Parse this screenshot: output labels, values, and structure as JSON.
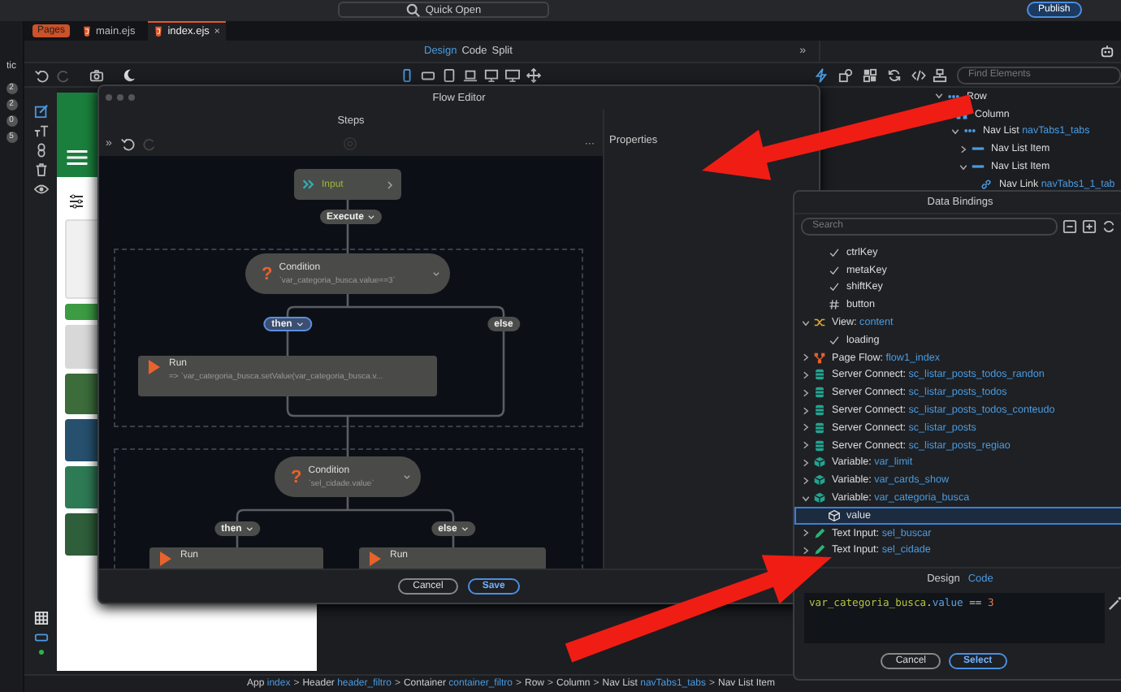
{
  "top_bar": {
    "quick_open": "Quick Open",
    "publish": "Publish"
  },
  "left_strip": {
    "label": "tic",
    "badges": [
      "2",
      "2",
      "0",
      "5"
    ]
  },
  "file_tabs": [
    {
      "label": "Pages",
      "kind": "badge",
      "selected": false
    },
    {
      "label": "main.ejs",
      "kind": "file",
      "selected": false
    },
    {
      "label": "index.ejs",
      "kind": "file",
      "selected": true,
      "close": "×"
    }
  ],
  "view_modes": [
    {
      "label": "Design",
      "selected": true
    },
    {
      "label": "Code",
      "selected": false
    },
    {
      "label": "Split",
      "selected": false
    }
  ],
  "panel_toggle": "»",
  "find_elements": {
    "placeholder": "Find Elements"
  },
  "tree": [
    {
      "kind": "row",
      "label": "Row",
      "expanded": true,
      "children": [
        {
          "kind": "column",
          "label": "Column",
          "children": [
            {
              "kind": "navlist",
              "label": "Nav List",
              "id": "navTabs1_tabs",
              "expanded": true,
              "children": [
                {
                  "kind": "item",
                  "label": "Nav List Item",
                  "expanded": false
                },
                {
                  "kind": "item",
                  "label": "Nav List Item",
                  "expanded": true,
                  "children": [
                    {
                      "kind": "link",
                      "label": "Nav Link",
                      "id": "navTabs1_1_tab"
                    }
                  ]
                }
              ]
            }
          ]
        }
      ]
    }
  ],
  "flow_editor": {
    "title": "Flow Editor",
    "steps": "Steps",
    "toggle": "»",
    "more": "···",
    "properties": "Properties",
    "input": "Input",
    "execute": "Execute",
    "blocks": [
      {
        "icon": "?",
        "condition": "Condition",
        "expression": "`var_categoria_busca.value==3`",
        "branches": [
          {
            "label": "then",
            "selected": true,
            "caret": true,
            "runs": [
              {
                "title": "Run",
                "expression": "=>  `var_categoria_busca.setValue(var_categoria_busca.v..."
              }
            ]
          },
          {
            "label": "else",
            "selected": false,
            "caret": false
          }
        ]
      },
      {
        "icon": "?",
        "condition": "Condition",
        "expression": "`sel_cidade.value`",
        "branches": [
          {
            "label": "then",
            "selected": false,
            "caret": true,
            "runs": [
              {
                "title": "Run"
              }
            ]
          },
          {
            "label": "else",
            "selected": false,
            "caret": true,
            "runs": [
              {
                "title": "Run"
              }
            ]
          }
        ]
      }
    ],
    "buttons": [
      {
        "label": "Cancel",
        "kind": "secondary"
      },
      {
        "label": "Save",
        "kind": "primary"
      }
    ]
  },
  "data_bindings": {
    "title": "Data Bindings",
    "search": {
      "placeholder": "Search"
    },
    "items": [
      {
        "children": [
          {
            "kind": "check",
            "name": "ctrlKey",
            "selected": false
          },
          {
            "kind": "check",
            "name": "metaKey",
            "selected": false
          },
          {
            "kind": "check",
            "name": "shiftKey",
            "selected": false
          },
          {
            "kind": "hash",
            "name": "button",
            "selected": false
          }
        ]
      },
      {
        "kind": "view",
        "name": "View:",
        "value": "content",
        "expanded": true,
        "selected": false,
        "children": [
          {
            "kind": "check",
            "name": "loading",
            "selected": false
          }
        ]
      },
      {
        "kind": "flow",
        "name": "Page Flow:",
        "value": "flow1_index",
        "expanded": false,
        "selected": false
      },
      {
        "kind": "server",
        "name": "Server Connect:",
        "value": "sc_listar_posts_todos_randon",
        "expanded": false,
        "selected": false
      },
      {
        "kind": "server",
        "name": "Server Connect:",
        "value": "sc_listar_posts_todos",
        "expanded": false,
        "selected": false
      },
      {
        "kind": "server",
        "name": "Server Connect:",
        "value": "sc_listar_posts_todos_conteudo",
        "expanded": false,
        "selected": false
      },
      {
        "kind": "server",
        "name": "Server Connect:",
        "value": "sc_listar_posts",
        "expanded": false,
        "selected": false
      },
      {
        "kind": "server",
        "name": "Server Connect:",
        "value": "sc_listar_posts_regiao",
        "expanded": false,
        "selected": false
      },
      {
        "kind": "variable",
        "name": "Variable:",
        "value": "var_limit",
        "expanded": false,
        "selected": false
      },
      {
        "kind": "variable",
        "name": "Variable:",
        "value": "var_cards_show",
        "expanded": false,
        "selected": false
      },
      {
        "kind": "variable",
        "name": "Variable:",
        "value": "var_categoria_busca",
        "expanded": true,
        "selected": false,
        "children": [
          {
            "kind": "value",
            "name": "value",
            "selected": true
          }
        ]
      },
      {
        "kind": "text_input",
        "name": "Text Input:",
        "value": "sel_buscar",
        "expanded": false,
        "selected": false
      },
      {
        "kind": "text_input",
        "name": "Text Input:",
        "value": "sel_cidade",
        "expanded": false,
        "selected": false
      }
    ],
    "tabs": [
      {
        "label": "Design",
        "selected": false
      },
      {
        "label": "Code",
        "selected": true
      }
    ],
    "code": [
      {
        "kind": "identifier",
        "text": "var_categoria_busca"
      },
      {
        "kind": "punct",
        "text": "."
      },
      {
        "kind": "property",
        "text": "value"
      },
      {
        "kind": "operator",
        "text": " == "
      },
      {
        "kind": "number",
        "text": "3"
      }
    ],
    "buttons": [
      {
        "label": "Cancel",
        "kind": "secondary"
      },
      {
        "label": "Select",
        "kind": "primary"
      }
    ]
  },
  "breadcrumb": [
    {
      "type": "App",
      "name": "index"
    },
    {
      "sep": ">",
      "type": "Header",
      "name": "header_filtro"
    },
    {
      "sep": ">",
      "type": "Container",
      "name": "container_filtro"
    },
    {
      "sep": ">",
      "type": "Row"
    },
    {
      "sep": ">",
      "type": "Column"
    },
    {
      "sep": ">",
      "type": "Nav List",
      "name": "navTabs1_tabs"
    },
    {
      "sep": ">",
      "type": "Nav List Item"
    }
  ]
}
